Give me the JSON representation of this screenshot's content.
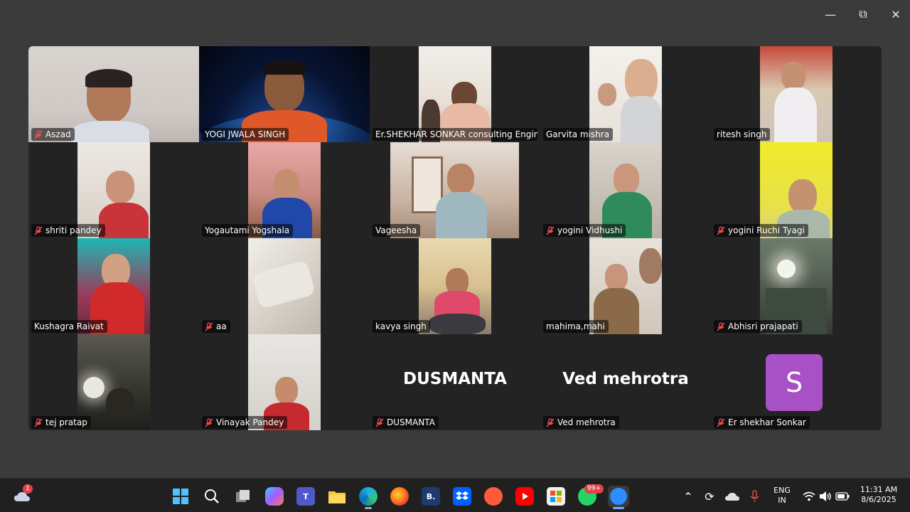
{
  "participants": [
    {
      "name": "Aszad",
      "muted": true
    },
    {
      "name": "YOGI JWALA SINGH",
      "muted": false
    },
    {
      "name": "Er.SHEKHAR SONKAR consulting Engine...",
      "muted": false
    },
    {
      "name": "Garvita mishra",
      "muted": false
    },
    {
      "name": "ritesh singh",
      "muted": false
    },
    {
      "name": "shriti pandey",
      "muted": true
    },
    {
      "name": "Yogautami Yogshala",
      "muted": false
    },
    {
      "name": "Vageesha",
      "muted": false
    },
    {
      "name": "yogini Vidhushi",
      "muted": true
    },
    {
      "name": "yogini Ruchi Tyagi",
      "muted": true
    },
    {
      "name": "Kushagra Raivat",
      "muted": false
    },
    {
      "name": "aa",
      "muted": true
    },
    {
      "name": "kavya singh",
      "muted": false
    },
    {
      "name": "mahima,mahi",
      "muted": false
    },
    {
      "name": "Abhisri prajapati",
      "muted": true
    },
    {
      "name": "tej pratap",
      "muted": true
    },
    {
      "name": "Vinayak Pandey",
      "muted": true
    },
    {
      "name": "DUSMANTA",
      "muted": true,
      "video_off_label": "DUSMANTA"
    },
    {
      "name": "Ved mehrotra",
      "muted": true,
      "video_off_label": "Ved mehrotra"
    },
    {
      "name": "Er shekhar Sonkar",
      "muted": true,
      "avatar_letter": "S"
    }
  ],
  "active_speaker": "YOGI JWALA SINGH",
  "taskbar": {
    "weather_badge": "1",
    "whatsapp_badge": "99+",
    "language": "ENG",
    "region": "IN",
    "time": "11:31 AM",
    "date": "8/6/2025",
    "apps": [
      "start-icon",
      "search-icon",
      "task-view-icon",
      "copilot-icon",
      "teams-icon",
      "file-explorer-icon",
      "edge-icon",
      "firefox-icon",
      "b-app-icon",
      "dropbox-icon",
      "screen-recorder-icon",
      "youtube-icon",
      "store-icon",
      "whatsapp-icon",
      "zoom-icon"
    ]
  },
  "colors": {
    "active_border": "#23c16b",
    "avatar_bg": "#a851c7"
  }
}
